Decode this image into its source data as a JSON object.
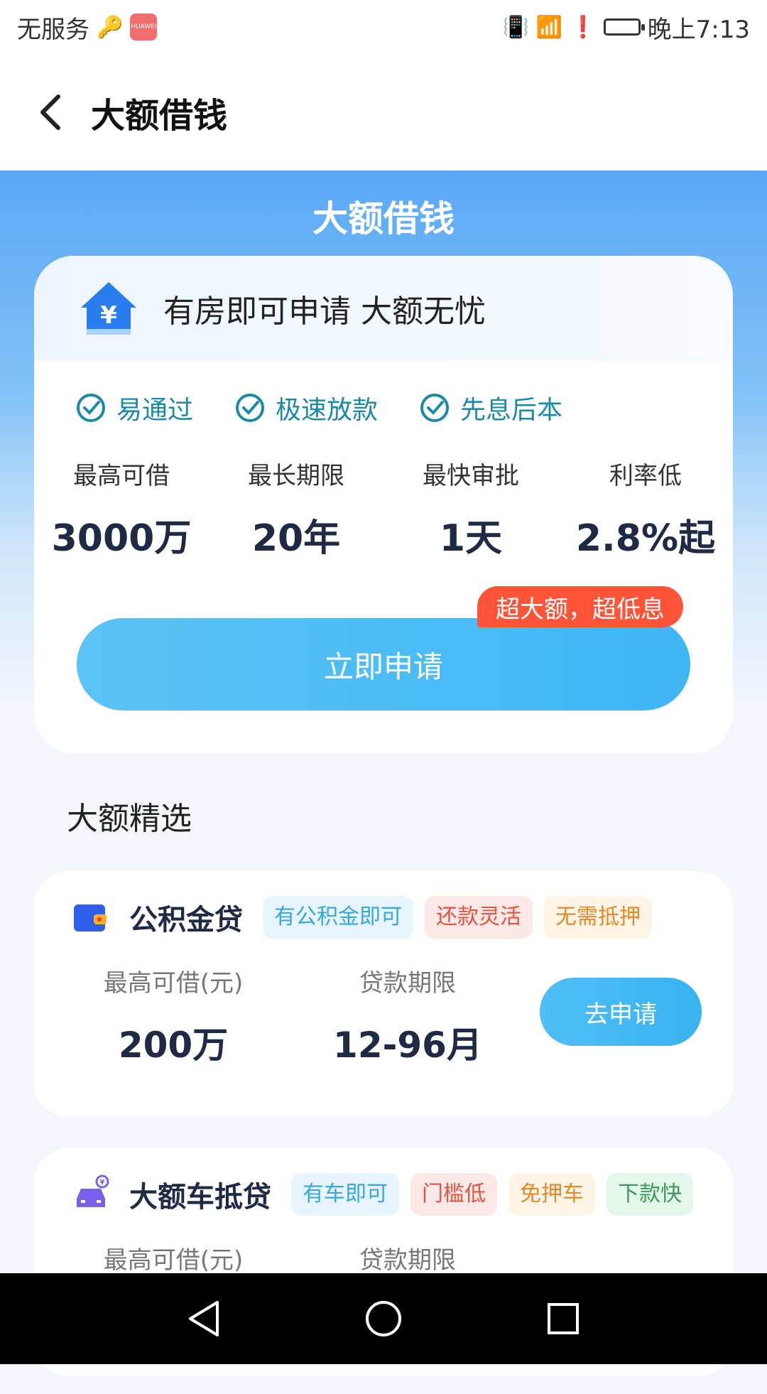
{
  "status_bar": {
    "carrier": "无服务",
    "time": "晚上7:13",
    "app_icon_text": "HUAWEI"
  },
  "nav": {
    "title": "大额借钱"
  },
  "hero": {
    "title": "大额借钱",
    "card_head": "有房即可申请 大额无忧",
    "features": [
      "易通过",
      "极速放款",
      "先息后本"
    ],
    "stats": [
      {
        "label": "最高可借",
        "value": "3000万"
      },
      {
        "label": "最长期限",
        "value": "20年"
      },
      {
        "label": "最快审批",
        "value": "1天"
      },
      {
        "label": "利率低",
        "value": "2.8%起"
      }
    ],
    "promo_badge": "超大额，超低息",
    "apply_button": "立即申请"
  },
  "section": {
    "title": "大额精选"
  },
  "products": [
    {
      "name": "公积金贷",
      "tags": [
        "有公积金即可",
        "还款灵活",
        "无需抵押"
      ],
      "amount_label": "最高可借(元)",
      "amount_value": "200万",
      "term_label": "贷款期限",
      "term_value": "12-96月",
      "button": "去申请"
    },
    {
      "name": "大额车抵贷",
      "tags": [
        "有车即可",
        "门槛低",
        "免押车",
        "下款快"
      ],
      "amount_label": "最高可借(元)",
      "term_label": "贷款期限"
    }
  ],
  "colors": {
    "accent": "#3eb6f3",
    "promo": "#ff5438",
    "feature_text": "#1a8aa8"
  }
}
